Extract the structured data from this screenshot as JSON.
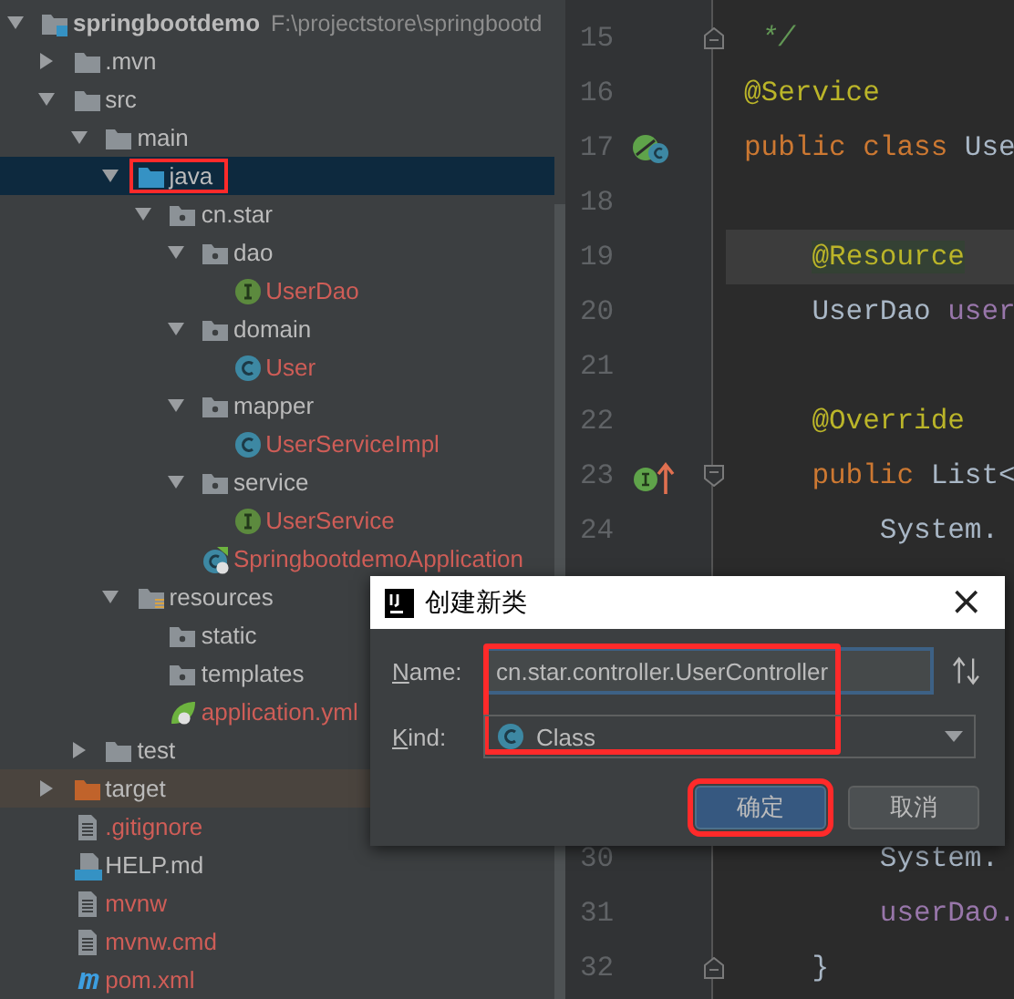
{
  "project_tree": {
    "root": {
      "name": "springbootdemo",
      "path": "F:\\projectstore\\springbootd",
      "kind": "module",
      "expanded": true,
      "selected": false,
      "highlighted": false,
      "untracked": false,
      "children": [
        {
          "name": ".mvn",
          "kind": "folder",
          "expanded": false,
          "selected": false,
          "highlighted": false,
          "untracked": false
        },
        {
          "name": "src",
          "kind": "folder",
          "expanded": true,
          "selected": false,
          "highlighted": false,
          "untracked": false,
          "children": [
            {
              "name": "main",
              "kind": "folder",
              "expanded": true,
              "selected": false,
              "highlighted": false,
              "untracked": false,
              "children": [
                {
                  "name": "java",
                  "kind": "source-folder",
                  "expanded": true,
                  "selected": true,
                  "highlighted": true,
                  "untracked": false,
                  "children": [
                    {
                      "name": "cn.star",
                      "kind": "package",
                      "expanded": true,
                      "selected": false,
                      "highlighted": false,
                      "untracked": false,
                      "children": [
                        {
                          "name": "dao",
                          "kind": "package",
                          "expanded": true,
                          "selected": false,
                          "highlighted": false,
                          "untracked": false,
                          "children": [
                            {
                              "name": "UserDao",
                              "kind": "interface",
                              "selected": false,
                              "highlighted": false,
                              "untracked": true
                            }
                          ]
                        },
                        {
                          "name": "domain",
                          "kind": "package",
                          "expanded": true,
                          "selected": false,
                          "highlighted": false,
                          "untracked": false,
                          "children": [
                            {
                              "name": "User",
                              "kind": "class",
                              "selected": false,
                              "highlighted": false,
                              "untracked": true
                            }
                          ]
                        },
                        {
                          "name": "mapper",
                          "kind": "package",
                          "expanded": true,
                          "selected": false,
                          "highlighted": false,
                          "untracked": false,
                          "children": [
                            {
                              "name": "UserServiceImpl",
                              "kind": "class",
                              "selected": false,
                              "highlighted": false,
                              "untracked": true
                            }
                          ]
                        },
                        {
                          "name": "service",
                          "kind": "package",
                          "expanded": true,
                          "selected": false,
                          "highlighted": false,
                          "untracked": false,
                          "children": [
                            {
                              "name": "UserService",
                              "kind": "interface",
                              "selected": false,
                              "highlighted": false,
                              "untracked": true
                            }
                          ]
                        },
                        {
                          "name": "SpringbootdemoApplication",
                          "kind": "spring-class",
                          "selected": false,
                          "highlighted": false,
                          "untracked": true
                        }
                      ]
                    }
                  ]
                },
                {
                  "name": "resources",
                  "kind": "resources-folder",
                  "expanded": true,
                  "selected": false,
                  "highlighted": false,
                  "untracked": false,
                  "children": [
                    {
                      "name": "static",
                      "kind": "package",
                      "selected": false,
                      "highlighted": false,
                      "untracked": false
                    },
                    {
                      "name": "templates",
                      "kind": "package",
                      "selected": false,
                      "highlighted": false,
                      "untracked": false
                    },
                    {
                      "name": "application.yml",
                      "kind": "yaml",
                      "selected": false,
                      "highlighted": false,
                      "untracked": true
                    }
                  ]
                }
              ]
            },
            {
              "name": "test",
              "kind": "folder",
              "expanded": false,
              "selected": false,
              "highlighted": false,
              "untracked": false
            }
          ]
        },
        {
          "name": "target",
          "kind": "excluded-folder",
          "expanded": false,
          "selected": false,
          "highlighted": false,
          "untracked": false
        },
        {
          "name": ".gitignore",
          "kind": "file",
          "selected": false,
          "highlighted": false,
          "untracked": true
        },
        {
          "name": "HELP.md",
          "kind": "markdown",
          "selected": false,
          "highlighted": false,
          "untracked": false
        },
        {
          "name": "mvnw",
          "kind": "file",
          "selected": false,
          "highlighted": false,
          "untracked": true
        },
        {
          "name": "mvnw.cmd",
          "kind": "file",
          "selected": false,
          "highlighted": false,
          "untracked": true
        },
        {
          "name": "pom.xml",
          "kind": "maven",
          "selected": false,
          "highlighted": false,
          "untracked": true
        }
      ]
    }
  },
  "editor": {
    "lines": [
      {
        "number": "15",
        "fold": {
          "kind": "end"
        },
        "current": false,
        "segments": [
          {
            "kind": "comment",
            "text": " */"
          }
        ]
      },
      {
        "number": "16",
        "current": false,
        "segments": [
          {
            "kind": "annotation",
            "text": "@Service"
          }
        ]
      },
      {
        "number": "17",
        "gutter_icon": {
          "kind": "bean-class"
        },
        "current": false,
        "segments": [
          {
            "kind": "keyword",
            "text": "public class "
          },
          {
            "kind": "plain",
            "text": "Use"
          }
        ]
      },
      {
        "number": "18",
        "current": false
      },
      {
        "number": "19",
        "current": true,
        "segments": [
          {
            "kind": "annotation-usage",
            "text": "    @Resource"
          }
        ]
      },
      {
        "number": "20",
        "current": false,
        "segments": [
          {
            "kind": "plain",
            "text": "    UserDao "
          },
          {
            "kind": "field",
            "text": "user"
          }
        ]
      },
      {
        "number": "21",
        "current": false
      },
      {
        "number": "22",
        "current": false,
        "segments": [
          {
            "kind": "annotation",
            "text": "    @Override"
          }
        ]
      },
      {
        "number": "23",
        "fold": {
          "kind": "start"
        },
        "gutter_icon": {
          "kind": "implements"
        },
        "current": false,
        "segments": [
          {
            "kind": "keyword",
            "text": "    public "
          },
          {
            "kind": "plain",
            "text": "List<"
          }
        ]
      },
      {
        "number": "24",
        "current": false,
        "segments": [
          {
            "kind": "plain",
            "text": "        System."
          }
        ]
      },
      {
        "number": "30",
        "current": false,
        "segments": [
          {
            "kind": "plain",
            "text": "        System."
          }
        ]
      },
      {
        "number": "31",
        "current": false,
        "segments": [
          {
            "kind": "field",
            "text": "        userDao."
          }
        ]
      },
      {
        "number": "32",
        "fold": {
          "kind": "end"
        },
        "current": false,
        "segments": [
          {
            "kind": "plain",
            "text": "    }"
          }
        ]
      }
    ]
  },
  "dialog": {
    "title": "创建新类",
    "close": "×",
    "fields_highlighted": true,
    "fields": [
      {
        "kind": "text",
        "label": "Name:",
        "value": "cn.star.controller.UserController",
        "focused": true
      },
      {
        "kind": "combo",
        "label": "Kind:",
        "value": "Class",
        "focused": false
      }
    ],
    "buttons": [
      {
        "label": "确定",
        "primary": true,
        "highlighted": true
      },
      {
        "label": "取消",
        "primary": false,
        "highlighted": false
      }
    ]
  }
}
